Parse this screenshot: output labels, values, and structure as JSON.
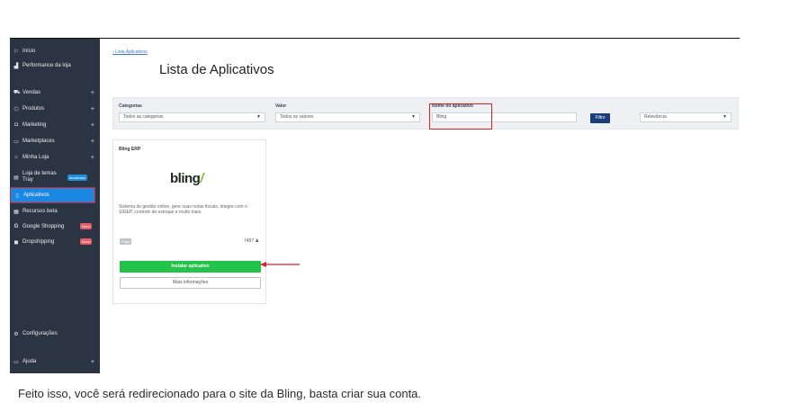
{
  "sidebar": {
    "items": [
      {
        "label": "Início",
        "icon": "flag-icon",
        "glyph": "⚐",
        "plus": ""
      },
      {
        "label": "Performance da loja",
        "icon": "bar-chart-icon",
        "glyph": "▟",
        "plus": ""
      },
      {
        "label": "Vendas",
        "icon": "cart-icon",
        "glyph": "⛟",
        "plus": "+"
      },
      {
        "label": "Produtos",
        "icon": "tag-icon",
        "glyph": "⬡",
        "plus": "+"
      },
      {
        "label": "Marketing",
        "icon": "bag-icon",
        "glyph": "◘",
        "plus": "+"
      },
      {
        "label": "Marketplaces",
        "icon": "monitor-icon",
        "glyph": "▭",
        "plus": "+"
      },
      {
        "label": "Minha Loja",
        "icon": "store-icon",
        "glyph": "⌂",
        "plus": "+"
      },
      {
        "label": "Loja de temas",
        "label2": "Tray",
        "icon": "theme-icon",
        "glyph": "▤",
        "badge": "atualizado"
      },
      {
        "label": "Aplicativos",
        "icon": "app-icon",
        "glyph": "▯"
      },
      {
        "label": "Recursos beta",
        "icon": "grid-icon",
        "glyph": "▦"
      },
      {
        "label": "Google Shopping",
        "icon": "google-icon",
        "glyph": "G",
        "badge": "Novo"
      },
      {
        "label": "Dropshipping",
        "icon": "box-icon",
        "glyph": "◼",
        "badge": "Novo"
      }
    ],
    "settings_label": "Configurações",
    "help_label": "Ajuda",
    "help_plus": "+"
  },
  "breadcrumb": "‹ Lista Aplicativos",
  "page_title": "Lista de Aplicativos",
  "filters": {
    "categories_label": "Categorias",
    "categories_value": "Todos as categorias",
    "value_label": "Valor",
    "value_value": "Todos os valores",
    "app_name_label": "Nome do aplicativo",
    "app_name_value": "Bling",
    "filter_button": "Filtro",
    "sort_value": "Relevância"
  },
  "card": {
    "title": "Bling ERP",
    "logo_text": "bling",
    "logo_mark": "/",
    "description": "Sistema de gestão online, gere suas notas fiscais, integre com o SIGEP, controle de estoque e muito mais.",
    "price_tag": "Pago",
    "installs": "7497",
    "install_button": "Instalar aplicativo",
    "more_button": "Mais informações"
  },
  "caption": "Feito isso, você será redirecionado para o site da Bling, basta criar sua conta.",
  "colors": {
    "sidebar_bg": "#2b3443",
    "active_item": "#1a87e0",
    "highlight": "#e21e24",
    "install_green": "#23c248",
    "filter_button": "#1b3d7a"
  }
}
